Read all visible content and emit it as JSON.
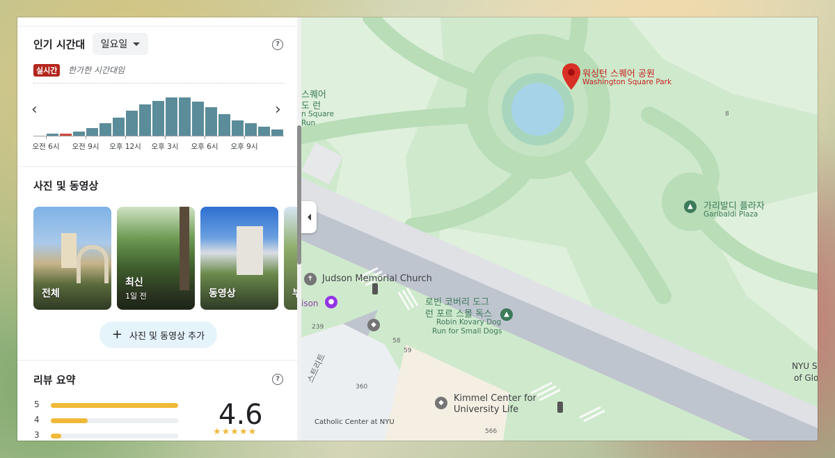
{
  "popular_times": {
    "title": "인기 시간대",
    "day": "일요일",
    "help": "?",
    "live_badge": "실시간",
    "live_note": "한가한 시간대임",
    "bars": [
      0.0,
      0.06,
      0.06,
      0.11,
      0.2,
      0.32,
      0.46,
      0.65,
      0.8,
      0.9,
      0.98,
      0.98,
      0.88,
      0.74,
      0.55,
      0.4,
      0.32,
      0.23,
      0.16
    ],
    "live_index": 2,
    "time_labels": [
      "오전 6시",
      "오전 9시",
      "오후 12시",
      "오후 3시",
      "오후 6시",
      "오후 9시"
    ]
  },
  "photos": {
    "title": "사진 및 동영상",
    "cards": [
      {
        "label": "전체",
        "sub": ""
      },
      {
        "label": "최신",
        "sub": "1일 전"
      },
      {
        "label": "동영상",
        "sub": ""
      },
      {
        "label": "부",
        "sub": ""
      }
    ],
    "add_button": "사진 및 동영상 추가"
  },
  "reviews": {
    "title": "리뷰 요약",
    "help": "?",
    "rows": [
      {
        "star": "5",
        "fraction": 1.0
      },
      {
        "star": "4",
        "fraction": 0.29
      },
      {
        "star": "3",
        "fraction": 0.08
      }
    ],
    "score": "4.6",
    "stars": "★★★★★"
  },
  "map": {
    "labels": {
      "washington_ko": "워싱턴 스퀘어 공원",
      "washington_en": "Washington Square Park",
      "left_ko1": "스퀘어",
      "left_ko2": "도 런",
      "left_en1": "n Square",
      "left_en2": "Run",
      "garibaldi_ko": "가리발디 플라자",
      "garibaldi_en": "Garibaldi Plaza",
      "judson": "Judson Memorial Church",
      "robin_ko1": "로빈 코버리 도그",
      "robin_ko2": "런 포르 스몰 독스",
      "robin_en1": "Robin Kovary Dog",
      "robin_en2": "Run for Small Dogs",
      "kimmel1": "Kimmel Center for",
      "kimmel2": "University Life",
      "catholic": "Catholic Center at NYU",
      "nyu1": "NYU S",
      "nyu2": "of Glo",
      "son": "ison",
      "street": "스트리트",
      "n8": "8",
      "n239": "239",
      "n58": "58",
      "n59": "59",
      "n360": "360",
      "n566": "566"
    }
  }
}
